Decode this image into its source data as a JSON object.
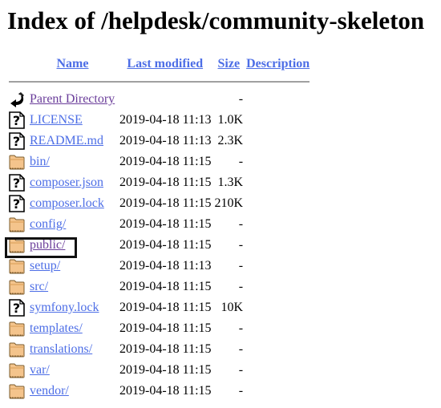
{
  "page": {
    "title": "Index of /helpdesk/community-skeleton"
  },
  "colors": {
    "link": "#4d6ee6",
    "visited_link": "#6a3d9a",
    "separator": "#a0a0a0",
    "folder": "#f4c48c",
    "highlight_box": "#111111"
  },
  "table": {
    "headers": {
      "name": "Name",
      "last_modified": "Last modified",
      "size": "Size",
      "description": "Description"
    },
    "rows": [
      {
        "icon": "back-icon",
        "name": "Parent Directory",
        "modified": "",
        "size": "-",
        "visited": true
      },
      {
        "icon": "unknown-file-icon",
        "name": "LICENSE",
        "modified": "2019-04-18 11:13",
        "size": "1.0K",
        "visited": false
      },
      {
        "icon": "unknown-file-icon",
        "name": "README.md",
        "modified": "2019-04-18 11:13",
        "size": "2.3K",
        "visited": false
      },
      {
        "icon": "folder-icon",
        "name": "bin/",
        "modified": "2019-04-18 11:15",
        "size": "-",
        "visited": false
      },
      {
        "icon": "unknown-file-icon",
        "name": "composer.json",
        "modified": "2019-04-18 11:15",
        "size": "1.3K",
        "visited": false
      },
      {
        "icon": "unknown-file-icon",
        "name": "composer.lock",
        "modified": "2019-04-18 11:15",
        "size": "210K",
        "visited": false
      },
      {
        "icon": "folder-icon",
        "name": "config/",
        "modified": "2019-04-18 11:15",
        "size": "-",
        "visited": false
      },
      {
        "icon": "folder-icon",
        "name": "public/",
        "modified": "2019-04-18 11:15",
        "size": "-",
        "visited": true,
        "highlighted": true
      },
      {
        "icon": "folder-icon",
        "name": "setup/",
        "modified": "2019-04-18 11:13",
        "size": "-",
        "visited": false
      },
      {
        "icon": "folder-icon",
        "name": "src/",
        "modified": "2019-04-18 11:15",
        "size": "-",
        "visited": false
      },
      {
        "icon": "unknown-file-icon",
        "name": "symfony.lock",
        "modified": "2019-04-18 11:15",
        "size": "10K",
        "visited": false
      },
      {
        "icon": "folder-icon",
        "name": "templates/",
        "modified": "2019-04-18 11:15",
        "size": "-",
        "visited": false
      },
      {
        "icon": "folder-icon",
        "name": "translations/",
        "modified": "2019-04-18 11:15",
        "size": "-",
        "visited": false
      },
      {
        "icon": "folder-icon",
        "name": "var/",
        "modified": "2019-04-18 11:15",
        "size": "-",
        "visited": false
      },
      {
        "icon": "folder-icon",
        "name": "vendor/",
        "modified": "2019-04-18 11:15",
        "size": "-",
        "visited": false
      }
    ]
  }
}
